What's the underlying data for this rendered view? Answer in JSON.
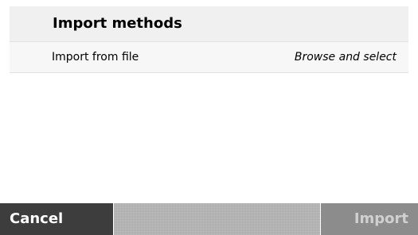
{
  "section": {
    "title": "Import methods"
  },
  "methods": [
    {
      "label": "Import from file",
      "action": "Browse and select"
    }
  ],
  "footer": {
    "cancel_label": "Cancel",
    "import_label": "Import",
    "import_enabled": false
  }
}
